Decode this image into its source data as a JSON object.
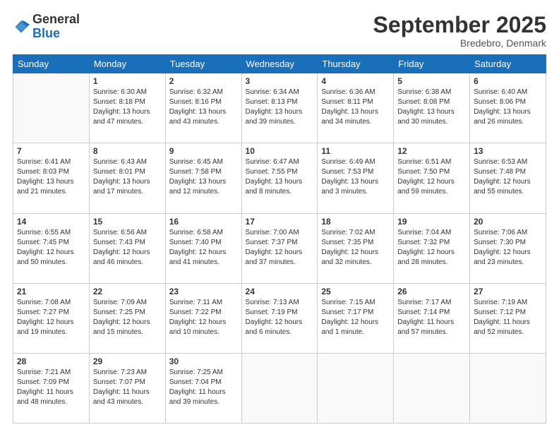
{
  "logo": {
    "general": "General",
    "blue": "Blue"
  },
  "header": {
    "month": "September 2025",
    "location": "Bredebro, Denmark"
  },
  "days_of_week": [
    "Sunday",
    "Monday",
    "Tuesday",
    "Wednesday",
    "Thursday",
    "Friday",
    "Saturday"
  ],
  "weeks": [
    [
      {
        "day": "",
        "empty": true
      },
      {
        "day": "1",
        "sunrise": "6:30 AM",
        "sunset": "8:18 PM",
        "daylight": "13 hours and 47 minutes."
      },
      {
        "day": "2",
        "sunrise": "6:32 AM",
        "sunset": "8:16 PM",
        "daylight": "13 hours and 43 minutes."
      },
      {
        "day": "3",
        "sunrise": "6:34 AM",
        "sunset": "8:13 PM",
        "daylight": "13 hours and 39 minutes."
      },
      {
        "day": "4",
        "sunrise": "6:36 AM",
        "sunset": "8:11 PM",
        "daylight": "13 hours and 34 minutes."
      },
      {
        "day": "5",
        "sunrise": "6:38 AM",
        "sunset": "8:08 PM",
        "daylight": "13 hours and 30 minutes."
      },
      {
        "day": "6",
        "sunrise": "6:40 AM",
        "sunset": "8:06 PM",
        "daylight": "13 hours and 26 minutes."
      }
    ],
    [
      {
        "day": "7",
        "sunrise": "6:41 AM",
        "sunset": "8:03 PM",
        "daylight": "13 hours and 21 minutes."
      },
      {
        "day": "8",
        "sunrise": "6:43 AM",
        "sunset": "8:01 PM",
        "daylight": "13 hours and 17 minutes."
      },
      {
        "day": "9",
        "sunrise": "6:45 AM",
        "sunset": "7:58 PM",
        "daylight": "13 hours and 12 minutes."
      },
      {
        "day": "10",
        "sunrise": "6:47 AM",
        "sunset": "7:55 PM",
        "daylight": "13 hours and 8 minutes."
      },
      {
        "day": "11",
        "sunrise": "6:49 AM",
        "sunset": "7:53 PM",
        "daylight": "13 hours and 3 minutes."
      },
      {
        "day": "12",
        "sunrise": "6:51 AM",
        "sunset": "7:50 PM",
        "daylight": "12 hours and 59 minutes."
      },
      {
        "day": "13",
        "sunrise": "6:53 AM",
        "sunset": "7:48 PM",
        "daylight": "12 hours and 55 minutes."
      }
    ],
    [
      {
        "day": "14",
        "sunrise": "6:55 AM",
        "sunset": "7:45 PM",
        "daylight": "12 hours and 50 minutes."
      },
      {
        "day": "15",
        "sunrise": "6:56 AM",
        "sunset": "7:43 PM",
        "daylight": "12 hours and 46 minutes."
      },
      {
        "day": "16",
        "sunrise": "6:58 AM",
        "sunset": "7:40 PM",
        "daylight": "12 hours and 41 minutes."
      },
      {
        "day": "17",
        "sunrise": "7:00 AM",
        "sunset": "7:37 PM",
        "daylight": "12 hours and 37 minutes."
      },
      {
        "day": "18",
        "sunrise": "7:02 AM",
        "sunset": "7:35 PM",
        "daylight": "12 hours and 32 minutes."
      },
      {
        "day": "19",
        "sunrise": "7:04 AM",
        "sunset": "7:32 PM",
        "daylight": "12 hours and 28 minutes."
      },
      {
        "day": "20",
        "sunrise": "7:06 AM",
        "sunset": "7:30 PM",
        "daylight": "12 hours and 23 minutes."
      }
    ],
    [
      {
        "day": "21",
        "sunrise": "7:08 AM",
        "sunset": "7:27 PM",
        "daylight": "12 hours and 19 minutes."
      },
      {
        "day": "22",
        "sunrise": "7:09 AM",
        "sunset": "7:25 PM",
        "daylight": "12 hours and 15 minutes."
      },
      {
        "day": "23",
        "sunrise": "7:11 AM",
        "sunset": "7:22 PM",
        "daylight": "12 hours and 10 minutes."
      },
      {
        "day": "24",
        "sunrise": "7:13 AM",
        "sunset": "7:19 PM",
        "daylight": "12 hours and 6 minutes."
      },
      {
        "day": "25",
        "sunrise": "7:15 AM",
        "sunset": "7:17 PM",
        "daylight": "12 hours and 1 minute."
      },
      {
        "day": "26",
        "sunrise": "7:17 AM",
        "sunset": "7:14 PM",
        "daylight": "11 hours and 57 minutes."
      },
      {
        "day": "27",
        "sunrise": "7:19 AM",
        "sunset": "7:12 PM",
        "daylight": "11 hours and 52 minutes."
      }
    ],
    [
      {
        "day": "28",
        "sunrise": "7:21 AM",
        "sunset": "7:09 PM",
        "daylight": "11 hours and 48 minutes."
      },
      {
        "day": "29",
        "sunrise": "7:23 AM",
        "sunset": "7:07 PM",
        "daylight": "11 hours and 43 minutes."
      },
      {
        "day": "30",
        "sunrise": "7:25 AM",
        "sunset": "7:04 PM",
        "daylight": "11 hours and 39 minutes."
      },
      {
        "day": "",
        "empty": true
      },
      {
        "day": "",
        "empty": true
      },
      {
        "day": "",
        "empty": true
      },
      {
        "day": "",
        "empty": true
      }
    ]
  ],
  "labels": {
    "sunrise": "Sunrise:",
    "sunset": "Sunset:",
    "daylight": "Daylight:"
  }
}
